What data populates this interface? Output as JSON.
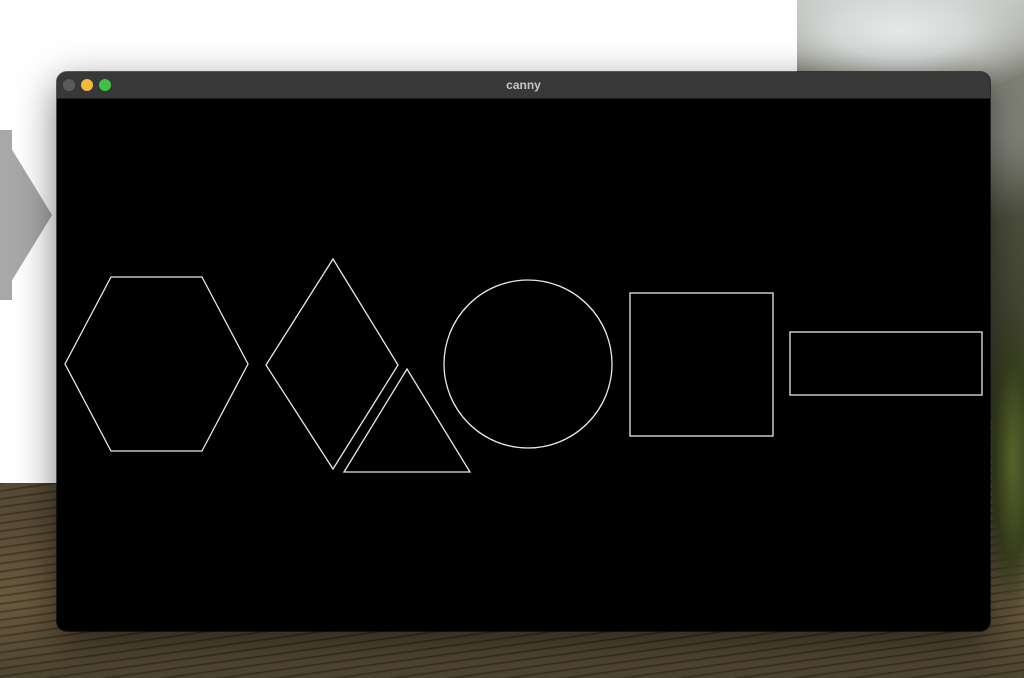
{
  "window": {
    "title": "canny",
    "controls": [
      {
        "name": "close",
        "color": "#5a5a5a"
      },
      {
        "name": "minimize",
        "color": "#f4b93a"
      },
      {
        "name": "maximize",
        "color": "#3fc14a"
      }
    ]
  },
  "canvas": {
    "background": "#000000",
    "edge_color": "#e8e8e8",
    "shapes": [
      "hexagon",
      "diamond",
      "triangle",
      "circle",
      "square",
      "rectangle"
    ]
  }
}
